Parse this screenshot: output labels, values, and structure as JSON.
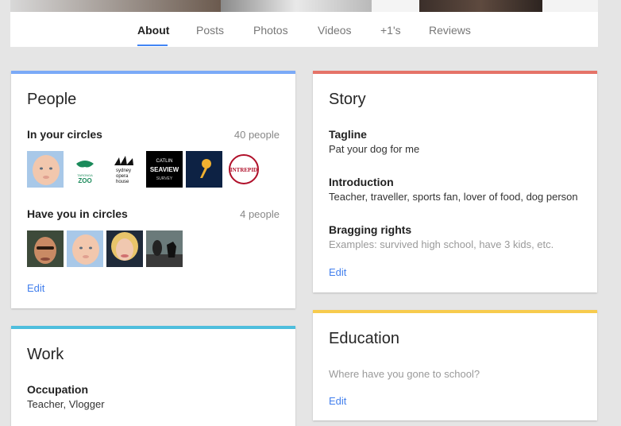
{
  "tabs": [
    {
      "label": "About",
      "active": true
    },
    {
      "label": "Posts"
    },
    {
      "label": "Photos"
    },
    {
      "label": "Videos"
    },
    {
      "label": "+1's"
    },
    {
      "label": "Reviews"
    }
  ],
  "colors": {
    "people_bar": "#7baaf7",
    "story_bar": "#e57368",
    "work_bar": "#4ebedd",
    "education_bar": "#f7cb4d",
    "link": "#427fed"
  },
  "people": {
    "title": "People",
    "in_circles": {
      "label": "In your circles",
      "count": "40 people",
      "avatars": [
        "baby-photo-avatar",
        "taronga-zoo-logo",
        "sydney-opera-house-logo",
        "catlin-seaview-survey-logo",
        "pin-logo-avatar",
        "intrepid-logo"
      ],
      "avatar_text": {
        "taronga": "TARONGA",
        "zoo": "ZOO",
        "opera_line1": "sydney",
        "opera_line2": "opera",
        "opera_line3": "house",
        "catlin": "CATLIN",
        "seaview": "SEAVIEW",
        "survey": "SURVEY",
        "intrepid": "INTREPID"
      }
    },
    "have_you": {
      "label": "Have you in circles",
      "count": "4 people",
      "avatars": [
        "man-photo-avatar",
        "baby-photo-avatar",
        "woman-photo-avatar",
        "man-with-dog-avatar"
      ]
    },
    "edit": "Edit"
  },
  "story": {
    "title": "Story",
    "tagline_label": "Tagline",
    "tagline": "Pat your dog for me",
    "intro_label": "Introduction",
    "intro": "Teacher, traveller, sports fan, lover of food, dog person",
    "bragging_label": "Bragging rights",
    "bragging_placeholder": "Examples: survived high school, have 3 kids, etc.",
    "edit": "Edit"
  },
  "work": {
    "title": "Work",
    "occupation_label": "Occupation",
    "occupation": "Teacher, Vlogger"
  },
  "education": {
    "title": "Education",
    "placeholder": "Where have you gone to school?",
    "edit": "Edit"
  }
}
